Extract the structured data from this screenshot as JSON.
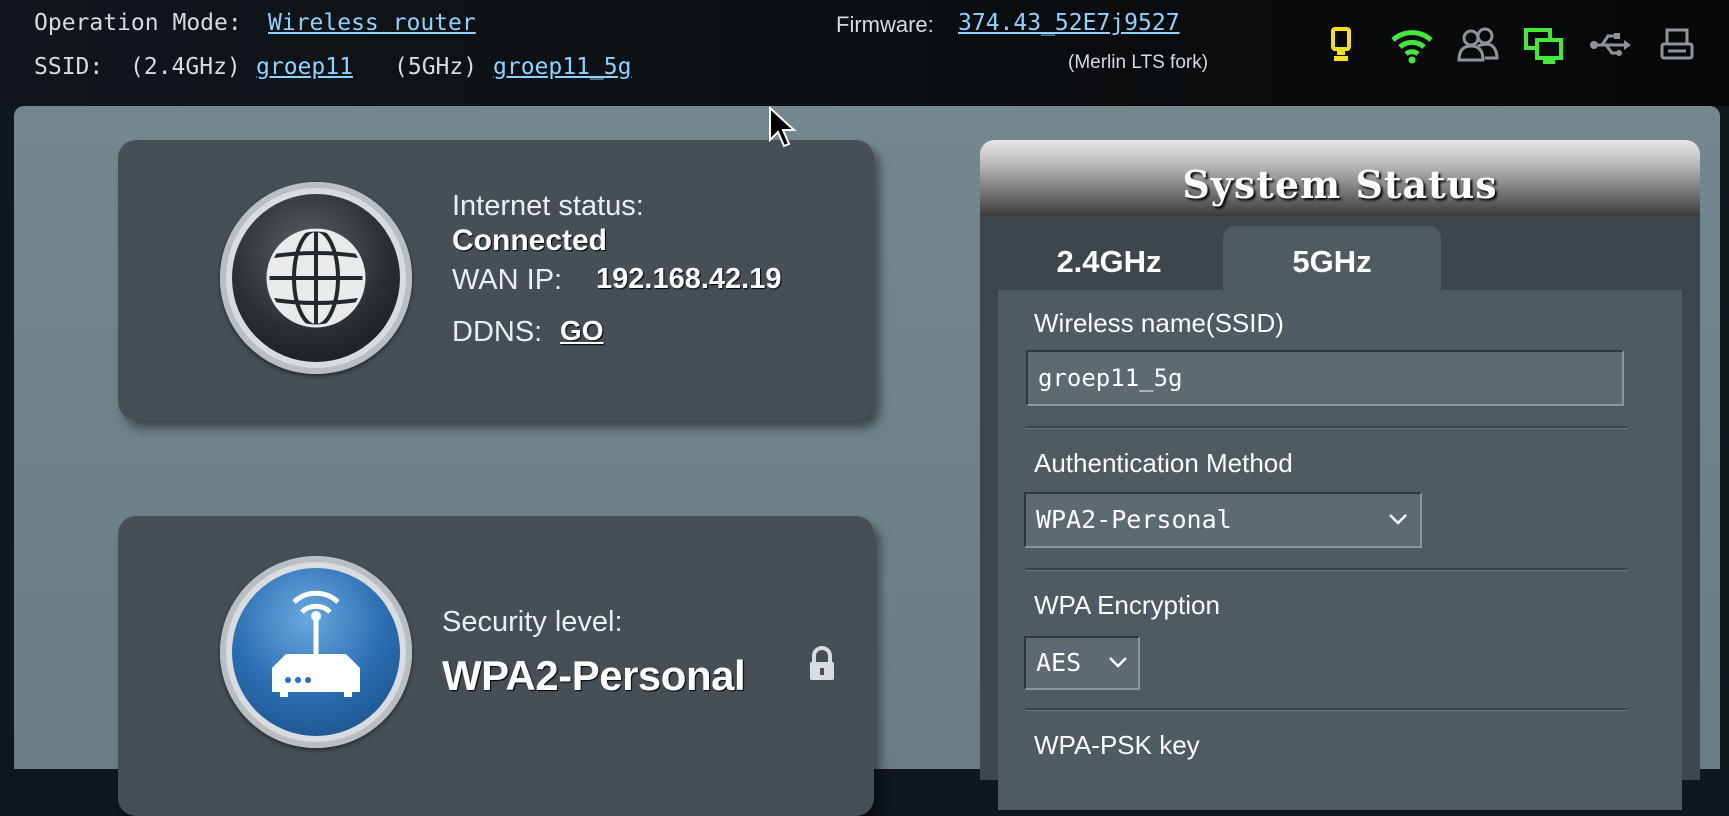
{
  "topbar": {
    "operation_mode_label": "Operation Mode:",
    "operation_mode_value": "Wireless router",
    "ssid_label": "SSID:",
    "ssid_24_label": "(2.4GHz)",
    "ssid_24_value": "groep11",
    "ssid_5_label": "(5GHz)",
    "ssid_5_value": "groep11_5g",
    "firmware_label": "Firmware:",
    "firmware_value": "374.43_52E7j9527",
    "firmware_sub": "(Merlin LTS fork)",
    "icons": [
      "usb-key-icon",
      "wifi-icon",
      "clients-icon",
      "network-map-icon",
      "usb-icon",
      "printer-icon"
    ],
    "colors": {
      "link": "#8fd1ff",
      "wifi_green": "#43e83b",
      "key_yellow": "#f4e020"
    }
  },
  "internet": {
    "status_label": "Internet status:",
    "status_value": "Connected",
    "wan_ip_label": "WAN IP:",
    "wan_ip_value": "192.168.42.19",
    "ddns_label": "DDNS:",
    "ddns_link": "GO"
  },
  "router": {
    "security_label": "Security level:",
    "security_value": "WPA2-Personal"
  },
  "system_status": {
    "title": "System Status",
    "tabs": [
      {
        "label": "2.4GHz",
        "active": false
      },
      {
        "label": "5GHz",
        "active": true
      }
    ],
    "ssid_label": "Wireless name(SSID)",
    "ssid_value": "groep11_5g",
    "auth_label": "Authentication Method",
    "auth_value": "WPA2-Personal",
    "encryption_label": "WPA Encryption",
    "encryption_value": "AES",
    "psk_label": "WPA-PSK key"
  }
}
